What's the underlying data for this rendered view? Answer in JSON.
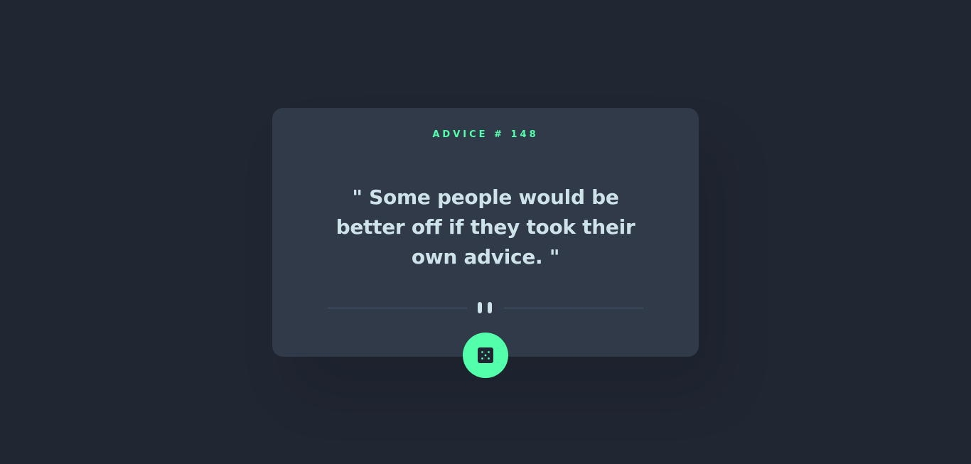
{
  "advice": {
    "id_label": "ADVICE # 148",
    "text": "\" Some people would be better off if they took their own advice. \""
  },
  "icons": {
    "divider": "pause-icon",
    "button": "dice-icon"
  },
  "colors": {
    "background": "#202632",
    "card": "#313A48",
    "accent": "#53FFAA",
    "text": "#CEE3E9",
    "divider": "#4F5D74"
  }
}
